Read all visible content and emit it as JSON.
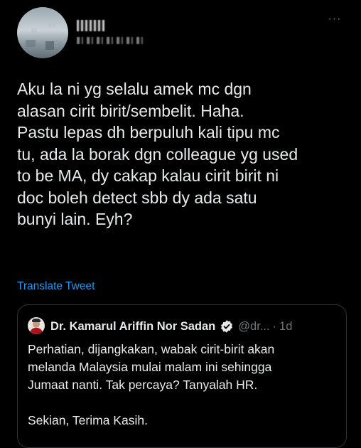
{
  "tweet": {
    "text": "Aku la ni yg selalu amek mc dgn\nalasan cirit birit/sembelit. Haha.\nPastu lepas dh berpuluh kali tipu mc\ntu, ada la borak dgn colleague yg used\nto be MA, dy cakap kalau cirit birit ni\ndoc boleh detect sbb dy ada satu\nbunyi lain. Eyh?",
    "translate_label": "Translate Tweet",
    "more_icon": "more-horizontal-icon",
    "more_glyph": "···"
  },
  "quoted_tweet": {
    "author_name": "Dr. Kamarul Ariffin Nor Sadan",
    "handle": "@dr...",
    "separator": "·",
    "time": "1d",
    "verified_icon": "verified-badge-icon",
    "text": "Perhatian, dijangkakan, wabak cirit-birit akan\nmelanda Malaysia mulai malam ini sehingga\nJumaat nanti. Tak percaya? Tanyalah HR.\n\nSekian, Terima Kasih."
  },
  "colors": {
    "background": "#000000",
    "text": "#e7e9ea",
    "secondary": "#71767b",
    "link": "#1d9bf0",
    "border": "#2f3336"
  }
}
